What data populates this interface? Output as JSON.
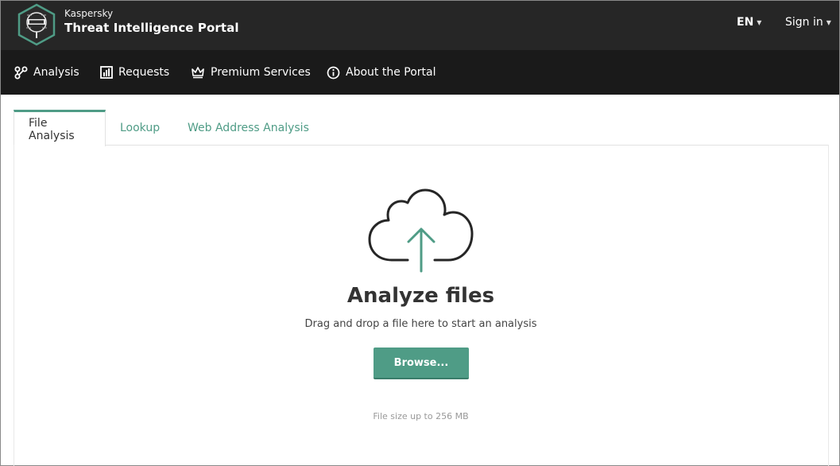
{
  "header": {
    "brand_small": "Kaspersky",
    "brand_title": "Threat Intelligence Portal",
    "language": "EN",
    "sign_in": "Sign in"
  },
  "nav": {
    "items": [
      {
        "label": "Analysis",
        "icon": "analysis-graph-icon"
      },
      {
        "label": "Requests",
        "icon": "bar-chart-icon"
      },
      {
        "label": "Premium Services",
        "icon": "crown-icon"
      },
      {
        "label": "About the Portal",
        "icon": "info-circle-icon"
      }
    ]
  },
  "tabs": [
    {
      "label": "File Analysis",
      "active": true
    },
    {
      "label": "Lookup",
      "active": false
    },
    {
      "label": "Web Address Analysis",
      "active": false
    }
  ],
  "upload": {
    "title": "Analyze files",
    "subtitle": "Drag and drop a file here to start an analysis",
    "button_label": "Browse...",
    "note": "File size up to 256 MB"
  },
  "colors": {
    "accent": "#4f9c86",
    "header_bg": "#262626",
    "nav_bg": "#1a1a1a"
  }
}
